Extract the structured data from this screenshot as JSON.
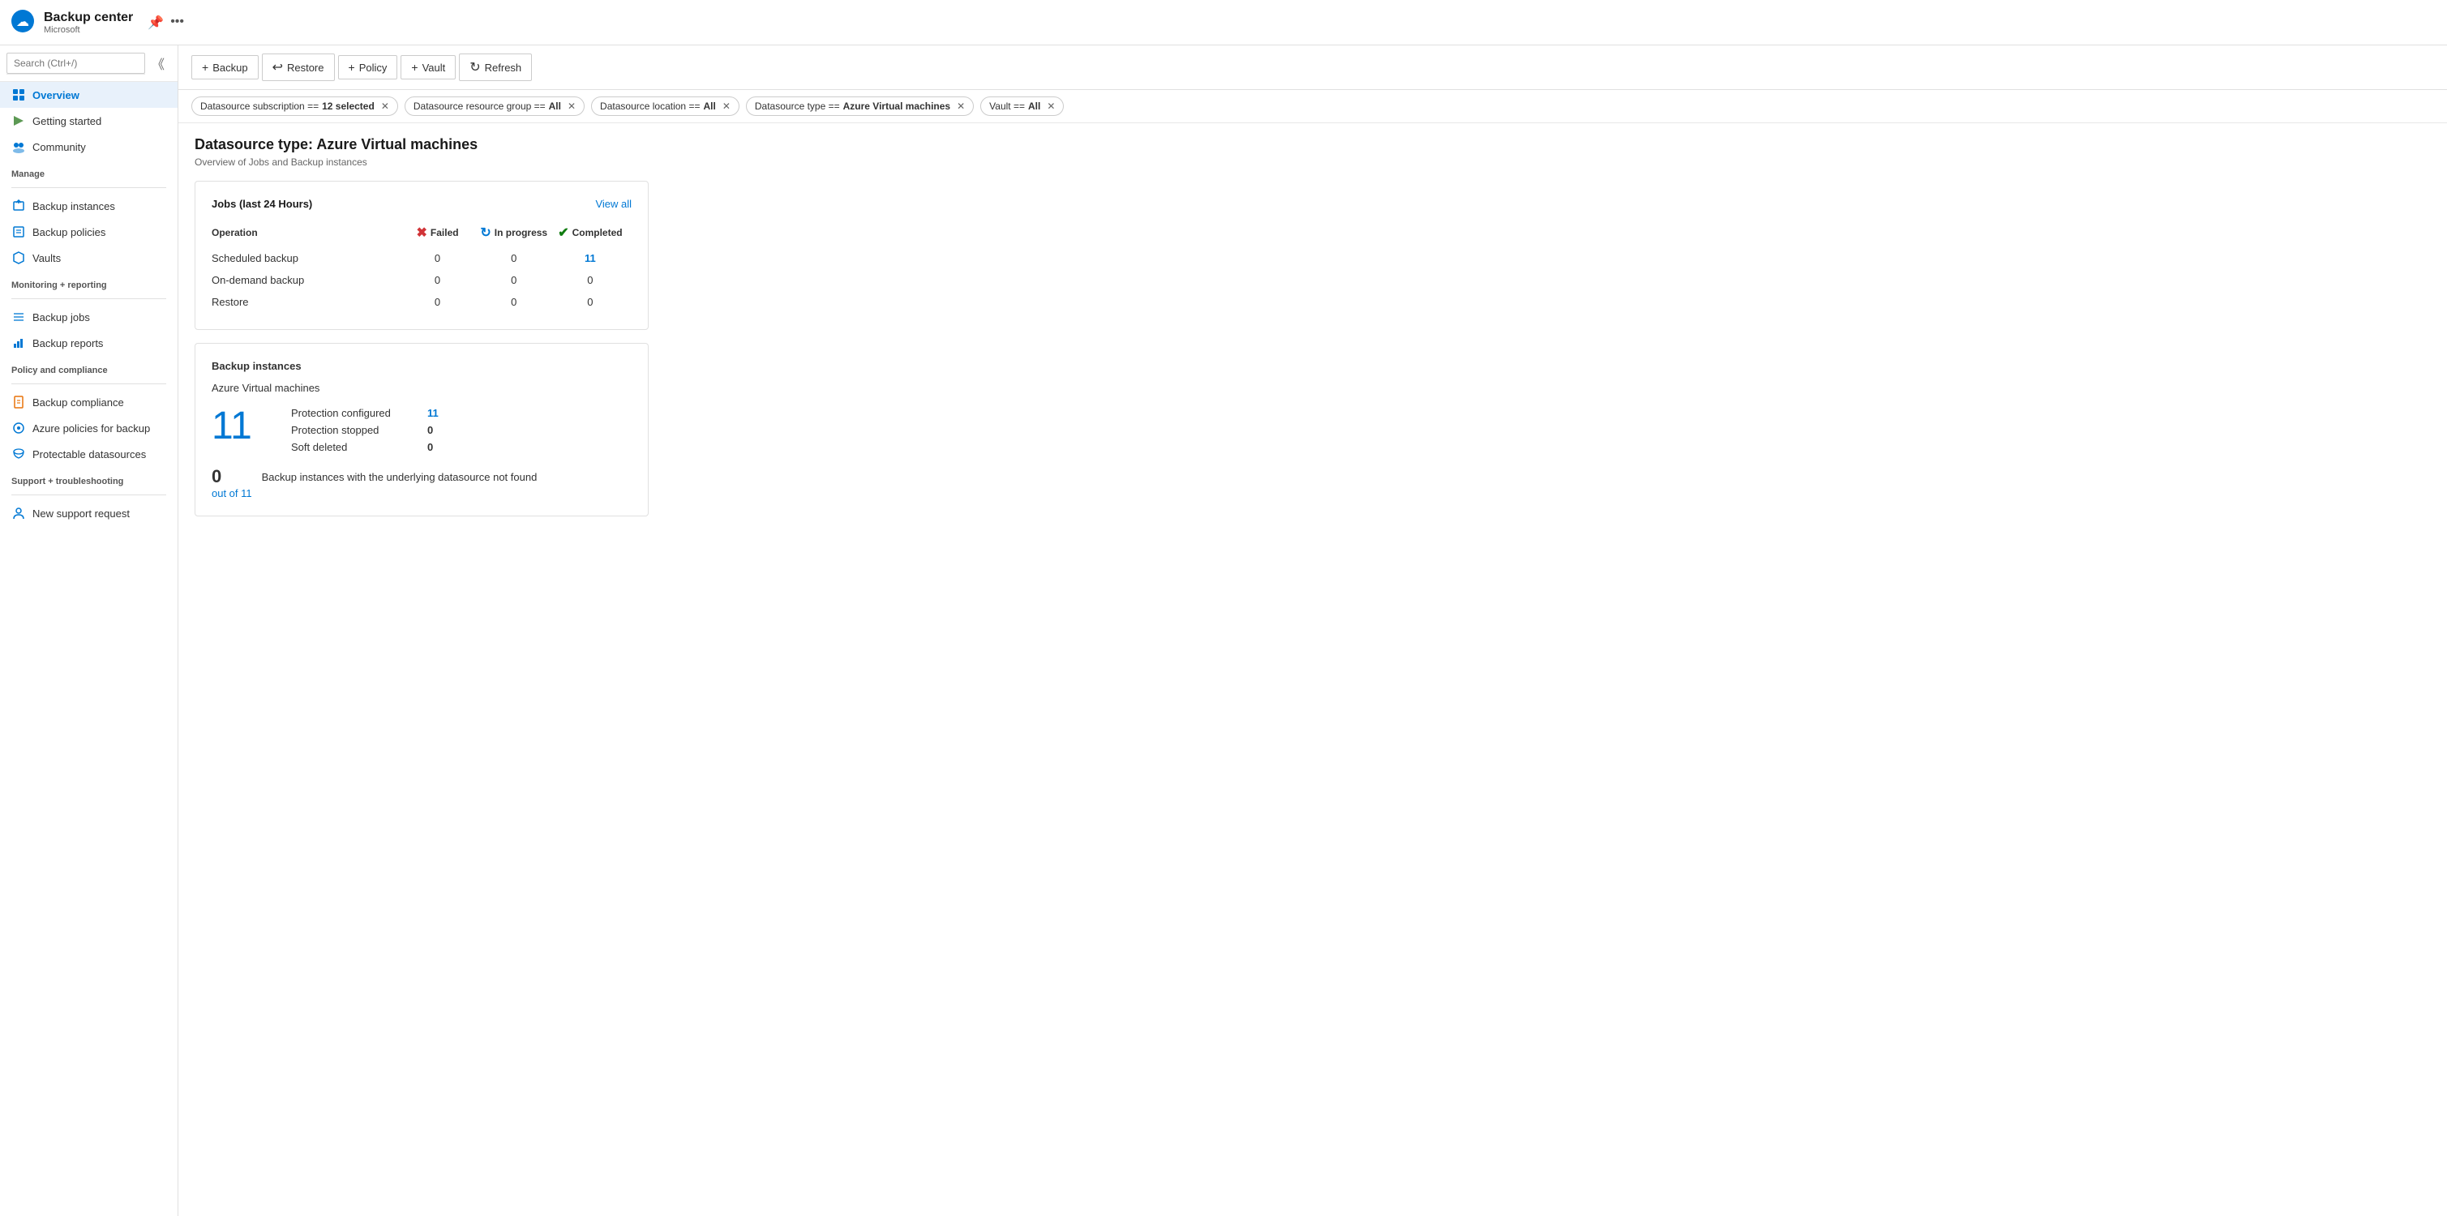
{
  "app": {
    "name": "Backup center",
    "sub": "Microsoft",
    "logo_color": "#0078d4"
  },
  "toolbar": {
    "buttons": [
      {
        "id": "backup",
        "label": "Backup",
        "icon": "+"
      },
      {
        "id": "restore",
        "label": "Restore",
        "icon": "↩"
      },
      {
        "id": "policy",
        "label": "Policy",
        "icon": "+"
      },
      {
        "id": "vault",
        "label": "Vault",
        "icon": "+"
      },
      {
        "id": "refresh",
        "label": "Refresh",
        "icon": "↻"
      }
    ]
  },
  "filters": [
    {
      "id": "subscription",
      "label": "Datasource subscription ==",
      "value": "12 selected"
    },
    {
      "id": "resource-group",
      "label": "Datasource resource group ==",
      "value": "All"
    },
    {
      "id": "location",
      "label": "Datasource location ==",
      "value": "All"
    },
    {
      "id": "type",
      "label": "Datasource type ==",
      "value": "Azure Virtual machines"
    },
    {
      "id": "vault",
      "label": "Vault ==",
      "value": "All"
    }
  ],
  "sidebar": {
    "search_placeholder": "Search (Ctrl+/)",
    "items_top": [
      {
        "id": "overview",
        "label": "Overview",
        "icon": "⊞",
        "active": true
      },
      {
        "id": "getting-started",
        "label": "Getting started",
        "icon": "🚀"
      },
      {
        "id": "community",
        "label": "Community",
        "icon": "👥"
      }
    ],
    "sections": [
      {
        "label": "Manage",
        "items": [
          {
            "id": "backup-instances",
            "label": "Backup instances",
            "icon": "💾"
          },
          {
            "id": "backup-policies",
            "label": "Backup policies",
            "icon": "📋"
          },
          {
            "id": "vaults",
            "label": "Vaults",
            "icon": "🏛"
          }
        ]
      },
      {
        "label": "Monitoring + reporting",
        "items": [
          {
            "id": "backup-jobs",
            "label": "Backup jobs",
            "icon": "≡"
          },
          {
            "id": "backup-reports",
            "label": "Backup reports",
            "icon": "📊"
          }
        ]
      },
      {
        "label": "Policy and compliance",
        "items": [
          {
            "id": "backup-compliance",
            "label": "Backup compliance",
            "icon": "📄"
          },
          {
            "id": "azure-policies",
            "label": "Azure policies for backup",
            "icon": "⚙"
          },
          {
            "id": "protectable-datasources",
            "label": "Protectable datasources",
            "icon": "🗄"
          }
        ]
      },
      {
        "label": "Support + troubleshooting",
        "items": [
          {
            "id": "new-support",
            "label": "New support request",
            "icon": "👤"
          }
        ]
      }
    ]
  },
  "page": {
    "title": "Datasource type: Azure Virtual machines",
    "subtitle": "Overview of Jobs and Backup instances"
  },
  "jobs_card": {
    "title": "Jobs (last 24 Hours)",
    "view_all_label": "View all",
    "columns": {
      "operation": "Operation",
      "failed": "Failed",
      "in_progress": "In progress",
      "completed": "Completed"
    },
    "rows": [
      {
        "operation": "Scheduled backup",
        "failed": "0",
        "in_progress": "0",
        "completed": "11",
        "completed_link": true
      },
      {
        "operation": "On-demand backup",
        "failed": "0",
        "in_progress": "0",
        "completed": "0",
        "completed_link": false
      },
      {
        "operation": "Restore",
        "failed": "0",
        "in_progress": "0",
        "completed": "0",
        "completed_link": false
      }
    ]
  },
  "backup_instances_card": {
    "section_title": "Backup instances",
    "vm_title": "Azure Virtual machines",
    "big_number": "11",
    "stats": [
      {
        "label": "Protection configured",
        "value": "11",
        "link": true
      },
      {
        "label": "Protection stopped",
        "value": "0",
        "link": false
      },
      {
        "label": "Soft deleted",
        "value": "0",
        "link": false
      }
    ],
    "footer_number": "0",
    "footer_outof": "out of 11",
    "footer_desc": "Backup instances with the underlying datasource not found"
  }
}
